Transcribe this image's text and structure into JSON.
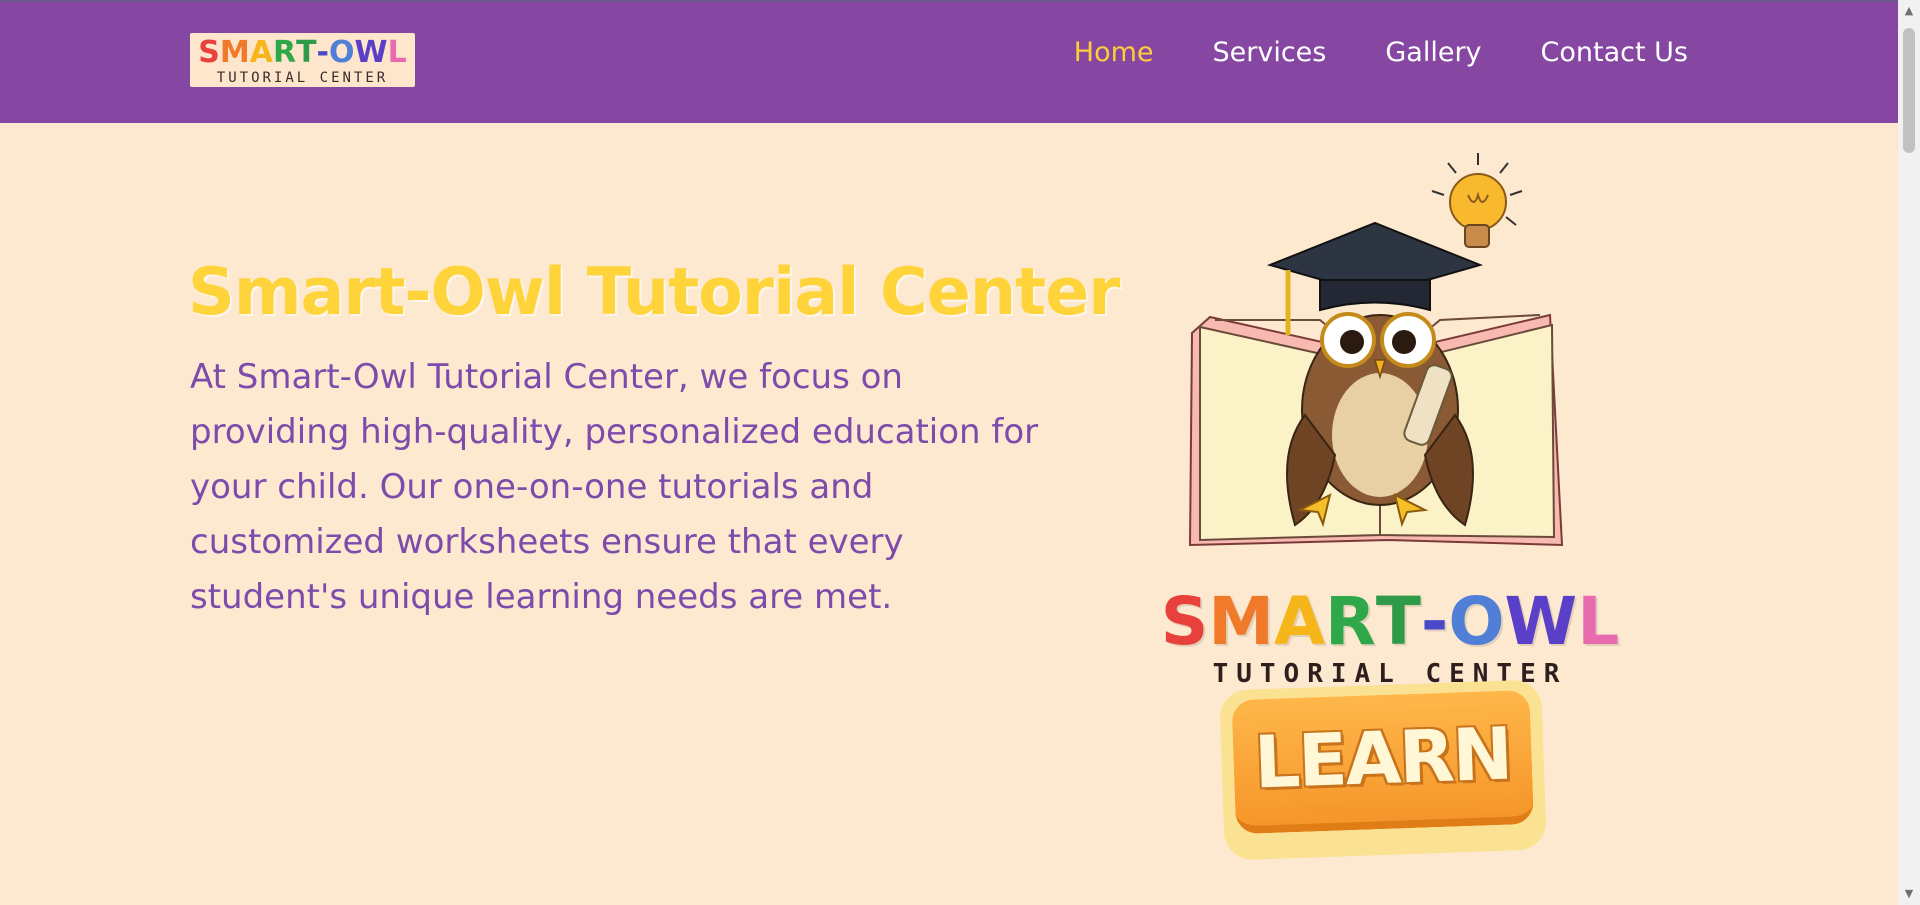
{
  "brand": {
    "word": [
      "S",
      "M",
      "A",
      "R",
      "T",
      "-",
      "O",
      "W",
      "L"
    ],
    "colors": [
      "#e8403a",
      "#f07a2a",
      "#f6b619",
      "#2fa84a",
      "#2f9a47",
      "#4a4ac8",
      "#4f7fd6",
      "#5a3fc8",
      "#e86bb0"
    ],
    "subtitle": "TUTORIAL CENTER"
  },
  "nav": {
    "items": [
      {
        "label": "Home",
        "active": true
      },
      {
        "label": "Services",
        "active": false
      },
      {
        "label": "Gallery",
        "active": false
      },
      {
        "label": "Contact Us",
        "active": false
      }
    ]
  },
  "hero": {
    "title": "Smart-Owl Tutorial Center",
    "description": "At Smart-Owl Tutorial Center, we focus on providing high-quality, personalized education for your child. Our one-on-one tutorials and customized worksheets ensure that every student's unique learning needs are met.",
    "button_label": "LEARN"
  },
  "icons": {
    "bulb": "lightbulb-icon",
    "owl": "owl-graduate-illustration",
    "book": "open-book-illustration"
  },
  "scrollbar": {
    "up": "▲",
    "down": "▼"
  }
}
